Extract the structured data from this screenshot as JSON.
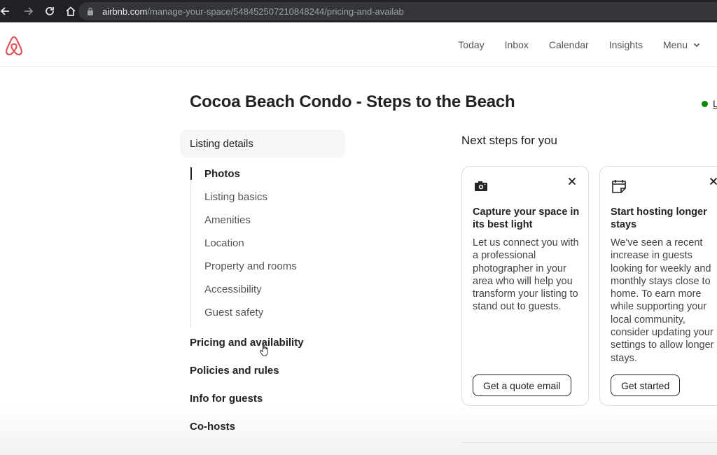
{
  "browser": {
    "url_host": "airbnb.com",
    "url_path": "/manage-your-space/548452507210848244/pricing-and-availab"
  },
  "header": {
    "nav": [
      "Today",
      "Inbox",
      "Calendar",
      "Insights"
    ],
    "menu_label": "Menu"
  },
  "listing": {
    "title": "Cocoa Beach Condo - Steps to the Beach",
    "status_link": "L",
    "status_color": "#078a07"
  },
  "sidebar": {
    "listing_details": "Listing details",
    "sub_items": [
      "Photos",
      "Listing basics",
      "Amenities",
      "Location",
      "Property and rooms",
      "Accessibility",
      "Guest safety"
    ],
    "active_sub_item": "Photos",
    "sections": [
      "Pricing and availability",
      "Policies and rules",
      "Info for guests",
      "Co-hosts"
    ]
  },
  "next_steps": {
    "title": "Next steps for you",
    "cards": [
      {
        "icon": "camera-icon",
        "title": "Capture your space in its best light",
        "body": "Let us connect you with a professional photographer in your area who will help you transform your listing to stand out to guests.",
        "button": "Get a quote email"
      },
      {
        "icon": "calendar-icon",
        "title": "Start hosting longer stays",
        "body": "We've seen a recent increase in guests looking for weekly and monthly stays close to home. To earn more while supporting your local community, consider updating your settings to allow longer stays.",
        "button": "Get started"
      }
    ]
  },
  "colors": {
    "brand": "#e0565b",
    "text": "#222222"
  }
}
